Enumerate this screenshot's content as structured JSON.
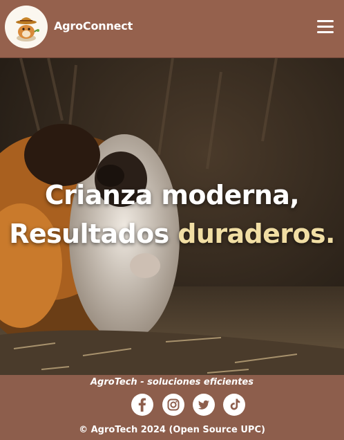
{
  "header": {
    "brand": "AgroConnect",
    "logo_icon": "guinea-pig-mascot-icon",
    "menu_icon": "hamburger-menu-icon"
  },
  "hero": {
    "line1": "Crianza moderna,",
    "line2_plain": "Resultados",
    "line2_accent": "duraderos.",
    "accent_color": "#f1dea4",
    "image": "guinea-pig-photo"
  },
  "footer": {
    "tagline": "AgroTech - soluciones eficientes",
    "social": [
      "facebook-icon",
      "instagram-icon",
      "twitter-icon",
      "tiktok-icon"
    ],
    "copyright": "© AgroTech 2024 (Open Source UPC)"
  },
  "colors": {
    "brand_brown": "#95614d",
    "footer_brown": "#8d5e4c"
  }
}
